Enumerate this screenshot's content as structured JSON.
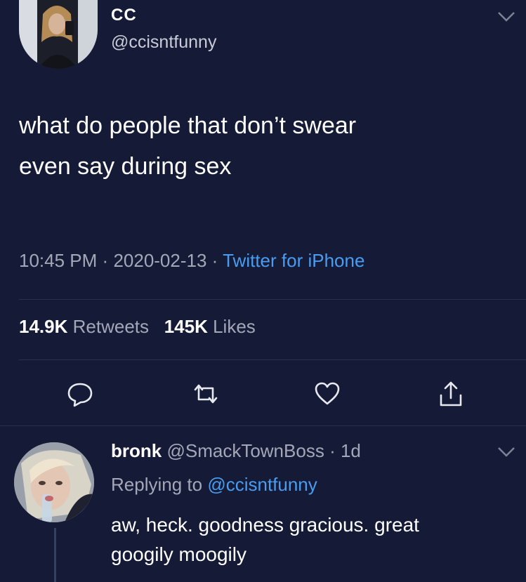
{
  "colors": {
    "background": "#151b37",
    "text_primary": "#ffffff",
    "text_secondary": "#a3a8b8",
    "link": "#4a9cf0",
    "divider": "#2a3150"
  },
  "main_tweet": {
    "author_name": "CC",
    "author_handle": "@ccisntfunny",
    "avatar_icon": "profile-photo",
    "menu_icon": "chevron-down-icon",
    "text_line_1": "what do people that don’t swear",
    "text_line_2": "even say during sex",
    "time": "10:45 PM",
    "separator": "·",
    "date": "2020-02-13",
    "source": "Twitter for iPhone",
    "retweet_count": "14.9K",
    "retweet_label": "Retweets",
    "like_count": "145K",
    "like_label": "Likes",
    "actions": [
      "reply-icon",
      "retweet-icon",
      "like-icon",
      "share-icon"
    ]
  },
  "reply": {
    "author_name": "bronk",
    "author_handle": "@SmackTownBoss",
    "separator": "·",
    "age": "1d",
    "replying_prefix": "Replying to",
    "replying_handle": "@ccisntfunny",
    "text_line_1": "aw, heck. goodness gracious. great",
    "text_line_2": "googily moogily",
    "menu_icon": "chevron-down-icon"
  }
}
